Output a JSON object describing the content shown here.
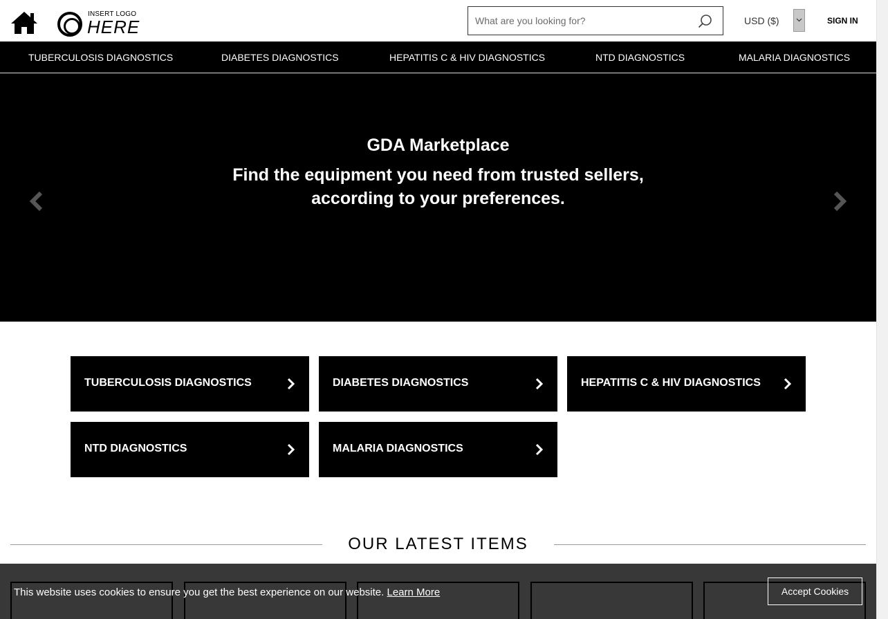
{
  "header": {
    "logo_small": "INSERT LOGO",
    "logo_big": "HERE",
    "search_placeholder": "What are you looking for?",
    "currency": "USD ($)",
    "signin": "SIGN IN"
  },
  "nav": {
    "items": [
      "TUBERCULOSIS DIAGNOSTICS",
      "DIABETES DIAGNOSTICS",
      "HEPATITIS C & HIV DIAGNOSTICS",
      "NTD DIAGNOSTICS",
      "MALARIA DIAGNOSTICS"
    ]
  },
  "hero": {
    "title": "GDA Marketplace",
    "subtitle": "Find the equipment you need from trusted sellers, according to your preferences."
  },
  "categories": [
    "TUBERCULOSIS DIAGNOSTICS",
    "DIABETES DIAGNOSTICS",
    "HEPATITIS C & HIV DIAGNOSTICS",
    "NTD DIAGNOSTICS",
    "MALARIA DIAGNOSTICS"
  ],
  "latest": {
    "title": "OUR LATEST ITEMS"
  },
  "cookie": {
    "message": "This website uses cookies to ensure you get the best experience on our website.",
    "learn_more": "Learn More",
    "accept": "Accept Cookies"
  },
  "colors": {
    "primary": "#000000",
    "background": "#ffffff",
    "text_light": "#ffffff"
  }
}
